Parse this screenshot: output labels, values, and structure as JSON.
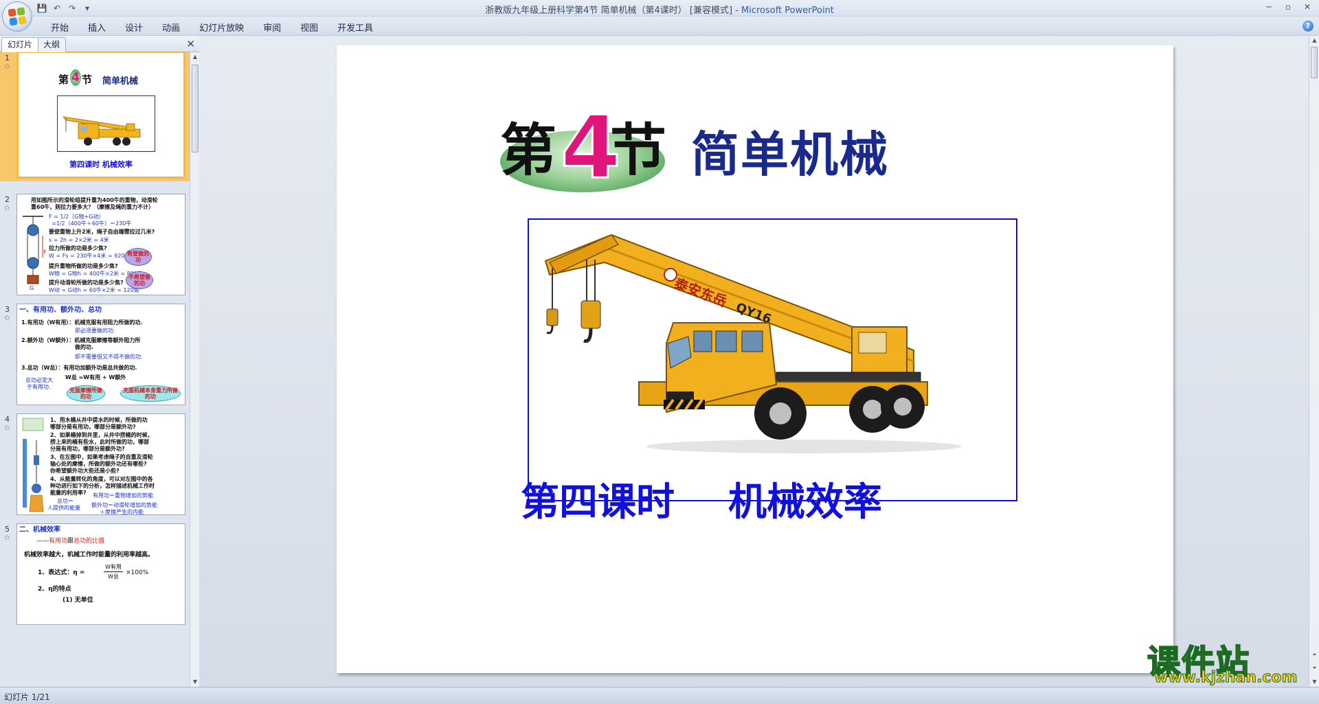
{
  "window": {
    "title": "浙教版九年级上册科学第4节 简单机械（第4课时） [兼容模式]",
    "app_name": "Microsoft PowerPoint",
    "separator": " - ",
    "minimize": "─",
    "maximize": "▫",
    "close": "✕"
  },
  "qat": {
    "save": "💾",
    "undo": "↶",
    "redo": "↷",
    "more": "▾"
  },
  "ribbon": {
    "tabs": [
      "开始",
      "插入",
      "设计",
      "动画",
      "幻灯片放映",
      "审阅",
      "视图",
      "开发工具"
    ],
    "help": "?"
  },
  "left_pane": {
    "tabs": [
      "幻灯片",
      "大纲"
    ],
    "close": "✕"
  },
  "thumbs": [
    {
      "num": "1",
      "heading_prefix": "第",
      "heading_num": "4",
      "heading_suffix": "节",
      "heading_title": "简单机械",
      "subtitle": "第四课时  机械效率"
    },
    {
      "num": "2",
      "lines": [
        {
          "text": "用如图所示的滑轮组提升重为400牛的重物，动滑轮",
          "c": "dark"
        },
        {
          "text": "重60牛，则拉力要多大？（摩擦及绳的重力不计）",
          "c": "dark"
        },
        {
          "text": "F = 1/2（G物+G动）",
          "c": "blue"
        },
        {
          "text": "=1/2（400牛＋60牛）＝230牛",
          "c": "blue"
        },
        {
          "text": "要使重物上升2米，绳子自由端需拉过几米?",
          "c": "dark"
        },
        {
          "text": "s = 2h = 2×2米 = 4米",
          "c": "blue"
        },
        {
          "text": "拉力所做的功是多少焦?",
          "c": "dark"
        },
        {
          "text": "W = Fs = 230牛×4米 = 920焦",
          "c": "blue"
        },
        {
          "text": "提升重物所做的功是多少焦?",
          "c": "dark"
        },
        {
          "text": "W物 = G物h = 400牛×2米 = 800焦",
          "c": "blue"
        },
        {
          "text": "提升动滑轮所做的功是多少焦?",
          "c": "dark"
        },
        {
          "text": "W动 = G动h = 60牛×2米 = 120焦",
          "c": "blue"
        }
      ],
      "bubble1": "希望做的功",
      "bubble2": "不希望做的功",
      "label_f": "F",
      "label_g": "G"
    },
    {
      "num": "3",
      "heading": "一、有用功、额外功、总功",
      "lines": [
        {
          "text": "1.有用功（W有用）：机械克服有用阻力所做的功.",
          "c": "dark"
        },
        {
          "text": "即必须要做的功.",
          "c": "blue"
        },
        {
          "text": "2.额外功（W额外）：机械克服摩擦等额外阻力所",
          "c": "dark"
        },
        {
          "text": "做的功.",
          "c": "dark"
        },
        {
          "text": "即不需要但又不得不做的功.",
          "c": "blue"
        },
        {
          "text": "3.总功（W总）：有用功加额外功是总共做的功.",
          "c": "dark"
        },
        {
          "text": "W总 =W有用 + W额外",
          "c": "dark"
        },
        {
          "text": "总功必定大",
          "c": "blue"
        },
        {
          "text": "于有用功.",
          "c": "blue"
        }
      ],
      "bubble1": "克服摩擦所做的功",
      "bubble2": "克服机械本身重力所做的功"
    },
    {
      "num": "4",
      "lines": [
        {
          "text": "1、用水桶从井中提水的时候，所做的功",
          "c": "dark"
        },
        {
          "text": "哪部分是有用功，哪部分是额外功?",
          "c": "dark"
        },
        {
          "text": "2、如果桶掉到井里，从井中捞桶的时候，",
          "c": "dark"
        },
        {
          "text": "捞上来的桶有些水，此时所做的功，哪部",
          "c": "dark"
        },
        {
          "text": "分是有用功，哪部分是额外功?",
          "c": "dark"
        },
        {
          "text": "3、在左图中，如果考虑绳子的自重及滑轮",
          "c": "dark"
        },
        {
          "text": "轴心处的摩擦，所做的额外功还有哪些?",
          "c": "dark"
        },
        {
          "text": "你希望额外功大些还是小些?",
          "c": "dark"
        },
        {
          "text": "4、从能量转化的角度，可以对左图中的各",
          "c": "dark"
        },
        {
          "text": "种功进行如下的分析，怎样描述机械工作时",
          "c": "dark"
        },
        {
          "text": "能量的利用率?",
          "c": "dark"
        },
        {
          "text": "总功＝",
          "c": "blue"
        },
        {
          "text": "人提供的能量",
          "c": "blue"
        },
        {
          "text": "有用功＝重物增加的势能",
          "c": "blue"
        },
        {
          "text": "额外功＝动滑轮增加的势能",
          "c": "blue"
        },
        {
          "text": "＋摩擦产生的内能",
          "c": "blue"
        }
      ]
    },
    {
      "num": "5",
      "heading": "二、机械效率",
      "sub_prefix": "——",
      "sub_a": "有用功",
      "sub_b": "跟",
      "sub_c": "总功",
      "sub_d": "的比值",
      "line1": "机械效率越大，机械工作时能量的利用率越高。",
      "line2": "1、表达式：η =",
      "frac_top": "W有用",
      "frac_bottom": "W总",
      "line2_end": "×100%",
      "line3": "2、η的特点",
      "line4": "(1) 无单位"
    }
  ],
  "slide": {
    "heading_prefix": "第",
    "heading_num": "4",
    "heading_suffix": "节",
    "heading_title": "简单机械",
    "crane_brand": "泰安东岳",
    "crane_model": "QY16",
    "subtitle": "第四课时    机械效率"
  },
  "status": {
    "text": "幻灯片 1/21"
  },
  "watermark": {
    "logo": "课件站",
    "url": "www.kjzhan.com"
  },
  "colors": {
    "ribbon_bg": "#dce4ef",
    "selected_thumb": "#f5b942",
    "slide_blue": "#1010e0",
    "heading_navy": "#1a2a8a",
    "magenta": "#e0157a",
    "watermark_yellow": "#f6cd1c"
  }
}
